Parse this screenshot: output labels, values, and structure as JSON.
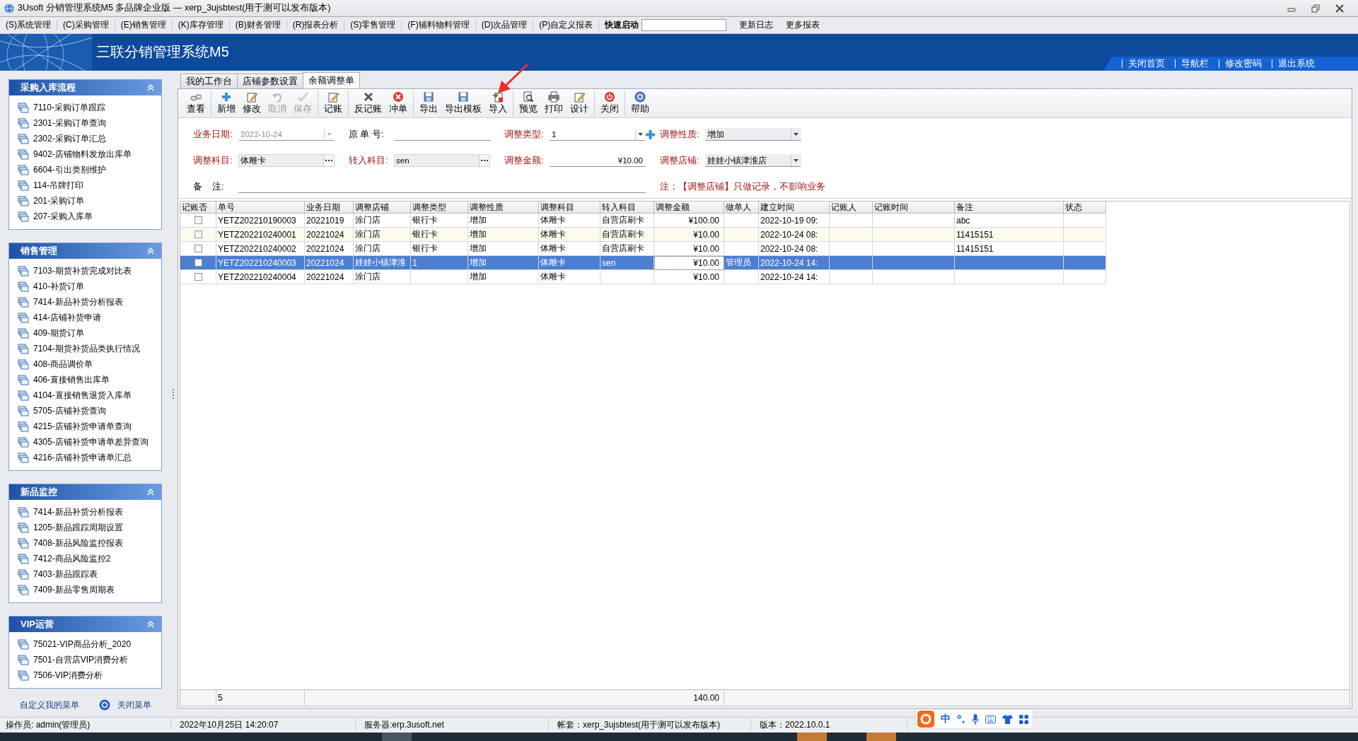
{
  "window": {
    "title": "3Usoft 分销管理系统M5 多品牌企业版 — xerp_3ujsbtest(用于测可以发布版本)"
  },
  "menu": {
    "items": [
      "(S)系统管理",
      "(C)采购管理",
      "(E)销售管理",
      "(K)库存管理",
      "(B)财务管理",
      "(R)报表分析",
      "(S)零售管理",
      "(F)辅料物料管理",
      "(D)次品管理",
      "(P)自定义报表"
    ],
    "quick_launch": "快速启动",
    "links": [
      "更新日志",
      "更多报表"
    ]
  },
  "banner": {
    "title": "三联分销管理系统M5",
    "links": [
      "关闭首页",
      "导航栏",
      "修改密码",
      "退出系统"
    ]
  },
  "sidebar": {
    "panels": [
      {
        "title": "采购入库流程",
        "expanded": true,
        "items": [
          "7110-采购订单跟踪",
          "2301-采购订单查询",
          "2302-采购订单汇总",
          "9402-店铺物料发放出库单",
          "6604-引出类别维护",
          "114-吊牌打印",
          "201-采购订单",
          "207-采购入库单"
        ]
      },
      {
        "title": "销售管理",
        "expanded": true,
        "items": [
          "7103-期货补货完成对比表",
          "410-补货订单",
          "7414-新品补货分析报表",
          "414-店铺补货申请",
          "409-期货订单",
          "7104-期货补货品类执行情况",
          "408-商品调价单",
          "406-直接销售出库单",
          "4104-直接销售退货入库单",
          "5705-店铺补货查询",
          "4215-店铺补货申请单查询",
          "4305-店铺补货申请单差异查询",
          "4216-店铺补货申请单汇总"
        ]
      },
      {
        "title": "新品监控",
        "expanded": true,
        "items": [
          "7414-新品补货分析报表",
          "1205-新品跟踪周期设置",
          "7408-新品风险监控报表",
          "7412-商品风险监控2",
          "7403-新品跟踪表",
          "7409-新品零售周期表"
        ]
      },
      {
        "title": "VIP运营",
        "expanded": true,
        "items": [
          "75021-VIP商品分析_2020",
          "7501-自营店VIP消费分析",
          "7506-VIP消费分析"
        ]
      }
    ],
    "footer": {
      "customize": "自定义我的菜单",
      "close": "关闭菜单"
    }
  },
  "tabs": [
    {
      "label": "我的工作台",
      "selected": false
    },
    {
      "label": "店铺参数设置",
      "selected": false
    },
    {
      "label": "余额调整单",
      "selected": true
    }
  ],
  "toolbar": {
    "groups": [
      [
        {
          "label": "查看",
          "disabled": false
        }
      ],
      [
        {
          "label": "新增",
          "disabled": false
        },
        {
          "label": "修改",
          "disabled": false
        },
        {
          "label": "取消",
          "disabled": true
        },
        {
          "label": "保存",
          "disabled": true
        }
      ],
      [
        {
          "label": "记账",
          "disabled": false
        }
      ],
      [
        {
          "label": "反记账",
          "disabled": false
        },
        {
          "label": "冲单",
          "disabled": false
        }
      ],
      [
        {
          "label": "导出",
          "disabled": false
        },
        {
          "label": "导出模板",
          "disabled": false
        },
        {
          "label": "导入",
          "disabled": false
        }
      ],
      [
        {
          "label": "预览",
          "disabled": false
        },
        {
          "label": "打印",
          "disabled": false
        },
        {
          "label": "设计",
          "disabled": false
        }
      ],
      [
        {
          "label": "关闭",
          "disabled": false
        }
      ],
      [
        {
          "label": "帮助",
          "disabled": false
        }
      ]
    ]
  },
  "form": {
    "rows": [
      [
        {
          "label": "业务日期:",
          "kind": "date",
          "value": "2022-10-24",
          "required": true,
          "disabled": true
        },
        {
          "label": "原 单 号:",
          "kind": "text",
          "required": false
        },
        {
          "label": "调整类型:",
          "kind": "combo",
          "value": "1",
          "required": true,
          "disabled": false,
          "add_button": true
        },
        {
          "label": "调整性质:",
          "kind": "combo",
          "value": "增加",
          "required": true,
          "disabled": false
        }
      ],
      [
        {
          "label": "调整科目:",
          "kind": "lookup",
          "value": "体雕卡",
          "required": true,
          "disabled": false
        },
        {
          "label": "转入科目:",
          "kind": "lookup",
          "value": "sen",
          "required": true,
          "disabled": false
        },
        {
          "label": "调整金额:",
          "kind": "money",
          "value": "¥10.00",
          "required": true,
          "disabled": false
        },
        {
          "label": "调整店铺:",
          "kind": "combo",
          "value": "娃娃小镇津淮店",
          "required": true,
          "disabled": false
        }
      ],
      [
        {
          "label": "备    注:",
          "kind": "memo",
          "required": false
        }
      ]
    ],
    "note": "注：【调整店铺】只做记录，不影响业务"
  },
  "table": {
    "columns": [
      "记账否",
      "单号",
      "业务日期",
      "调整店铺",
      "调整类型",
      "调整性质",
      "调整科目",
      "转入科目",
      "调整金额",
      "做单人",
      "建立时间",
      "记账人",
      "记账时间",
      "备注",
      "状态"
    ],
    "rows": [
      {
        "selected": false,
        "checked": false,
        "cells": [
          "",
          "YETZ202210190003",
          "20221019",
          "涂门店",
          "银行卡",
          "增加",
          "体雕卡",
          "自营店刷卡",
          "¥100.00",
          "",
          "2022-10-19 09:",
          "",
          "",
          "abc",
          ""
        ]
      },
      {
        "selected": false,
        "checked": false,
        "cells": [
          "",
          "YETZ202210240001",
          "20221024",
          "涂门店",
          "银行卡",
          "增加",
          "体雕卡",
          "自营店刷卡",
          "¥10.00",
          "",
          "2022-10-24 08:",
          "",
          "",
          "11415151",
          ""
        ]
      },
      {
        "selected": false,
        "checked": false,
        "cells": [
          "",
          "YETZ202210240002",
          "20221024",
          "涂门店",
          "银行卡",
          "增加",
          "体雕卡",
          "自营店刷卡",
          "¥10.00",
          "",
          "2022-10-24 08:",
          "",
          "",
          "11415151",
          ""
        ]
      },
      {
        "selected": true,
        "checked": false,
        "cells": [
          "",
          "YETZ202210240003",
          "20221024",
          "娃娃小镇津淮",
          "1",
          "增加",
          "体雕卡",
          "sen",
          "¥10.00",
          "管理员",
          "2022-10-24 14:",
          "",
          "",
          "",
          ""
        ]
      },
      {
        "selected": false,
        "checked": false,
        "cells": [
          "",
          "YETZ202210240004",
          "20221024",
          "涂门店",
          "",
          "增加",
          "体雕卡",
          "",
          "¥10.00",
          "",
          "2022-10-24 14:",
          "",
          "",
          "",
          ""
        ]
      }
    ],
    "footer": {
      "count": "5",
      "total": "140.00"
    }
  },
  "status_bar": [
    "操作员: admin(管理员)",
    "2022年10月25日 14:20:07",
    "服务器:erp.3usoft.net",
    "帐套：xerp_3ujsbtest(用于测可以发布版本)",
    "版本：2022.10.0.1"
  ],
  "ime": {
    "mode": "中"
  }
}
